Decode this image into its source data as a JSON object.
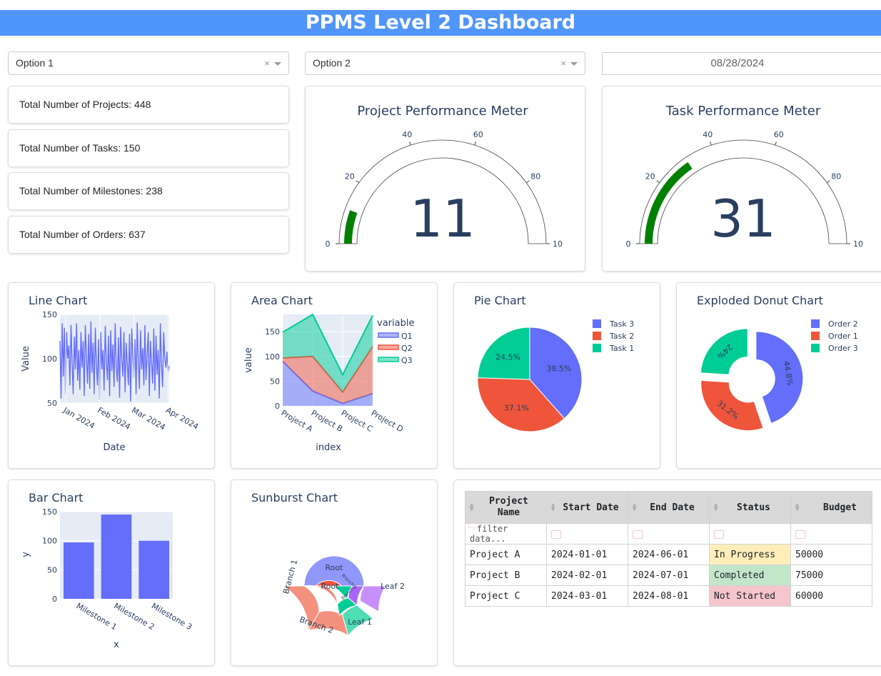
{
  "header": {
    "title": "PPMS Level 2 Dashboard"
  },
  "filters": {
    "dropdown1": {
      "value": "Option 1"
    },
    "dropdown2": {
      "value": "Option 2"
    },
    "clear_glyph": "×",
    "date": "08/28/2024"
  },
  "stats": [
    {
      "label": "Total Number of Projects: 448"
    },
    {
      "label": "Total Number of Tasks: 150"
    },
    {
      "label": "Total Number of Milestones: 238"
    },
    {
      "label": "Total Number of Orders: 637"
    }
  ],
  "gauges": [
    {
      "title": "Project Performance Meter",
      "value": 11,
      "ticks": [
        "0",
        "20",
        "40",
        "60",
        "80",
        "10"
      ]
    },
    {
      "title": "Task Performance Meter",
      "value": 31,
      "ticks": [
        "0",
        "20",
        "40",
        "60",
        "80",
        "10"
      ]
    }
  ],
  "colors": {
    "banner": "#4f95fb",
    "gauge_bar": "#008000",
    "blue": "#636efa",
    "red": "#ef553b",
    "green": "#00cc96",
    "purple": "#ab63fa",
    "plot_bg": "#e5ecf6"
  },
  "charts": {
    "line": {
      "title": "Line Chart",
      "xlabel": "Date",
      "ylabel": "Value",
      "yticks": [
        "150",
        "100",
        "50"
      ],
      "xticks": [
        "Jan 2024",
        "Feb 2024",
        "Mar 2024",
        "Apr 2024"
      ]
    },
    "area": {
      "title": "Area Chart",
      "xlabel": "index",
      "ylabel": "value",
      "legend_title": "variable",
      "yticks": [
        "150",
        "100",
        "50",
        "0"
      ]
    },
    "pie": {
      "title": "Pie Chart"
    },
    "donut": {
      "title": "Exploded Donut Chart"
    },
    "bar": {
      "title": "Bar Chart",
      "xlabel": "x",
      "ylabel": "y",
      "yticks": [
        "150",
        "100",
        "50",
        "0"
      ]
    },
    "sunburst": {
      "title": "Sunburst Chart"
    }
  },
  "chart_data": [
    {
      "type": "line",
      "x_range": [
        "2024-01-01",
        "2024-04-10"
      ],
      "ylim": [
        50,
        150
      ],
      "values": [
        120,
        55,
        140,
        80,
        135,
        60,
        130,
        100,
        115,
        70,
        138,
        95,
        60,
        125,
        88,
        140,
        75,
        110,
        65,
        130,
        90,
        120,
        58,
        138,
        102,
        72,
        128,
        66,
        142,
        84,
        118,
        60,
        135,
        95,
        70,
        122,
        54,
        130,
        88,
        110,
        64,
        137,
        97,
        76,
        126,
        58,
        132,
        86,
        116,
        68,
        140,
        92,
        74,
        124,
        56,
        136,
        100,
        80,
        130,
        62,
        118,
        94,
        70,
        128,
        52,
        134,
        104,
        78,
        122,
        60,
        141,
        98,
        66,
        132,
        88,
        112,
        70,
        138,
        76,
        104,
        130,
        58,
        120,
        95,
        72,
        134,
        64,
        126,
        82,
        110,
        55,
        140,
        92,
        68,
        130,
        100,
        90,
        108,
        85,
        92
      ]
    },
    {
      "type": "area",
      "categories": [
        "Project A",
        "Project B",
        "Project C",
        "Project D"
      ],
      "ylim": [
        0,
        185
      ],
      "series": [
        {
          "name": "Q1",
          "values": [
            90,
            30,
            5,
            25
          ]
        },
        {
          "name": "Q2",
          "values": [
            7,
            70,
            23,
            95
          ]
        },
        {
          "name": "Q3",
          "values": [
            52,
            85,
            35,
            63
          ]
        }
      ]
    },
    {
      "type": "pie",
      "labels": [
        "Task 3",
        "Task 2",
        "Task 1"
      ],
      "values": [
        38.5,
        37.1,
        24.5
      ],
      "text": [
        "38.5%",
        "37.1%",
        "24.5%"
      ]
    },
    {
      "type": "pie",
      "hole": 0.4,
      "labels": [
        "Order 2",
        "Order 1",
        "Order 3"
      ],
      "values": [
        44.8,
        31.2,
        24
      ],
      "text": [
        "44.8%",
        "31.2%",
        "24%"
      ]
    },
    {
      "type": "bar",
      "categories": [
        "Milestone 1",
        "Milestone 2",
        "Milestone 3"
      ],
      "values": [
        97,
        145,
        100
      ],
      "ylim": [
        0,
        150
      ]
    },
    {
      "type": "sunburst",
      "inner": [
        {
          "label": "Root",
          "share": 0.5
        },
        {
          "label": "Root",
          "share": 0.5
        }
      ],
      "labels": [
        "Root",
        "Root",
        "Branch 1",
        "Branch 2",
        "Leaf 1",
        "Leaf 2",
        "Branch 1",
        "Branch 2"
      ]
    }
  ],
  "table": {
    "columns": [
      "Project\nName",
      "Start Date",
      "End Date",
      "Status",
      "Budget"
    ],
    "filter_placeholder": "filter data...",
    "rows": [
      {
        "name": "Project A",
        "start": "2024-01-01",
        "end": "2024-06-01",
        "status": "In Progress",
        "budget": "50000",
        "status_color": "#ffeeba"
      },
      {
        "name": "Project B",
        "start": "2024-02-01",
        "end": "2024-07-01",
        "status": "Completed",
        "budget": "75000",
        "status_color": "#c3e6cb"
      },
      {
        "name": "Project C",
        "start": "2024-03-01",
        "end": "2024-08-01",
        "status": "Not Started",
        "budget": "60000",
        "status_color": "#f5c6cb"
      }
    ]
  }
}
